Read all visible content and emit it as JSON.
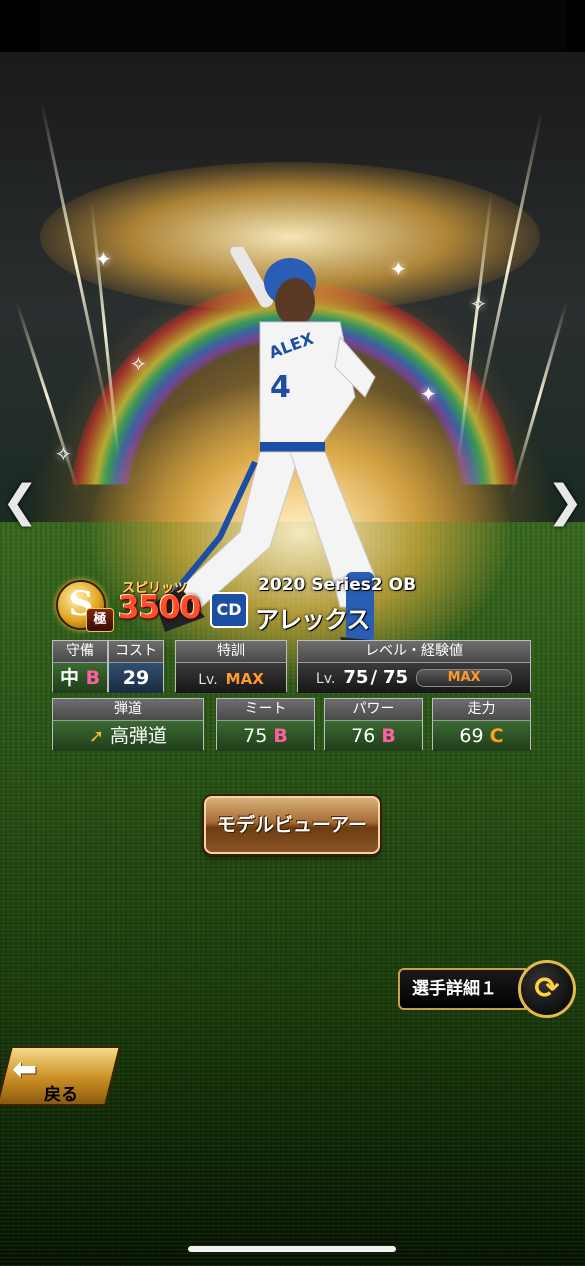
{
  "card": {
    "rank": "S",
    "rank_sub": "極",
    "spirits_label": "スピリッツ",
    "spirits_value": "3500",
    "team_logo": "CD",
    "series": "2020 Series2 OB",
    "player_name": "アレックス",
    "jersey_name": "ALEX",
    "jersey_number": "4"
  },
  "stats": {
    "defense": {
      "label": "守備",
      "position": "中",
      "grade": "B"
    },
    "cost": {
      "label": "コスト",
      "value": "29"
    },
    "special_training": {
      "label": "特訓",
      "lv_prefix": "Lv.",
      "value": "MAX"
    },
    "level_exp": {
      "label": "レベル・経験値",
      "lv_prefix": "Lv.",
      "current": "75",
      "slash": "/",
      "max": "75",
      "exp_bar_label": "MAX",
      "exp_fill": 1.0
    },
    "trajectory": {
      "label": "弾道",
      "value": "高弾道"
    },
    "meet": {
      "label": "ミート",
      "value": "75",
      "grade": "B"
    },
    "power": {
      "label": "パワー",
      "value": "76",
      "grade": "B"
    },
    "speed": {
      "label": "走力",
      "value": "69",
      "grade": "C"
    }
  },
  "buttons": {
    "model_viewer": "モデルビューアー",
    "player_detail": "選手詳細１",
    "back": "戻る",
    "prev_icon": "chevron-left",
    "next_icon": "chevron-right",
    "cycle_icon": "cycle-arrows"
  },
  "colors": {
    "grade_b": "#ff5fa0",
    "grade_c": "#ffa020",
    "max_text": "#ff9a2a",
    "spirits": "#ff4d2e",
    "team": "#1c4ea3"
  }
}
